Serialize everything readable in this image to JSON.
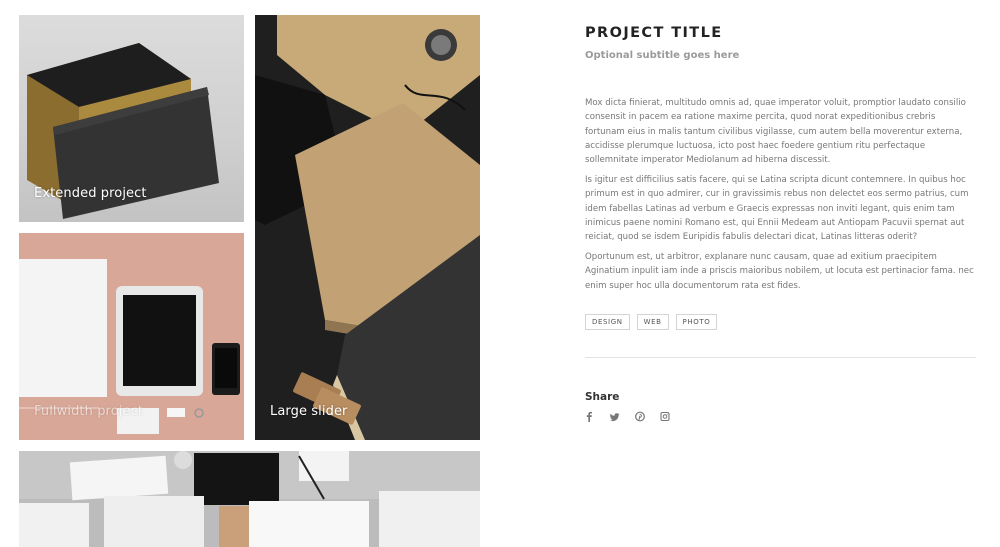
{
  "gallery": {
    "tiles": [
      {
        "caption": "Extended project"
      },
      {
        "caption": "Large slider"
      },
      {
        "caption": "Fullwidth project"
      },
      {
        "caption": ""
      }
    ]
  },
  "project": {
    "title": "PROJECT TITLE",
    "subtitle": "Optional subtitle goes here",
    "paragraphs": [
      "Mox dicta finierat, multitudo omnis ad, quae imperator voluit, promptior laudato consilio consensit in pacem ea ratione maxime percita, quod norat expeditionibus crebris fortunam eius in malis tantum civilibus vigilasse, cum autem bella moverentur externa, accidisse plerumque luctuosa, icto post haec foedere gentium ritu perfectaque sollemnitate imperator Mediolanum ad hiberna discessit.",
      "Is igitur est difficilius satis facere, qui se Latina scripta dicunt contemnere. In quibus hoc primum est in quo admirer, cur in gravissimis rebus non delectet eos sermo patrius, cum idem fabellas Latinas ad verbum e Graecis expressas non inviti legant, quis enim tam inimicus paene nomini Romano est, qui Ennii Medeam aut Antiopam Pacuvii spernat aut reiciat, quod se isdem Euripidis fabulis delectari dicat, Latinas litteras oderit?",
      "Oportunum est, ut arbitror, explanare nunc causam, quae ad exitium praecipitem Aginatium inpulit iam inde a priscis maioribus nobilem, ut locuta est pertinacior fama. nec enim super hoc ulla documentorum rata est fides."
    ],
    "tags": [
      "DESIGN",
      "WEB",
      "PHOTO"
    ],
    "share_label": "Share",
    "social_icons": [
      "facebook-icon",
      "twitter-icon",
      "pinterest-icon",
      "instagram-icon"
    ]
  },
  "colors": {
    "title": "#222222",
    "body_text": "#777777",
    "subtitle": "#9a9a9a",
    "border": "#d5d5d5"
  }
}
